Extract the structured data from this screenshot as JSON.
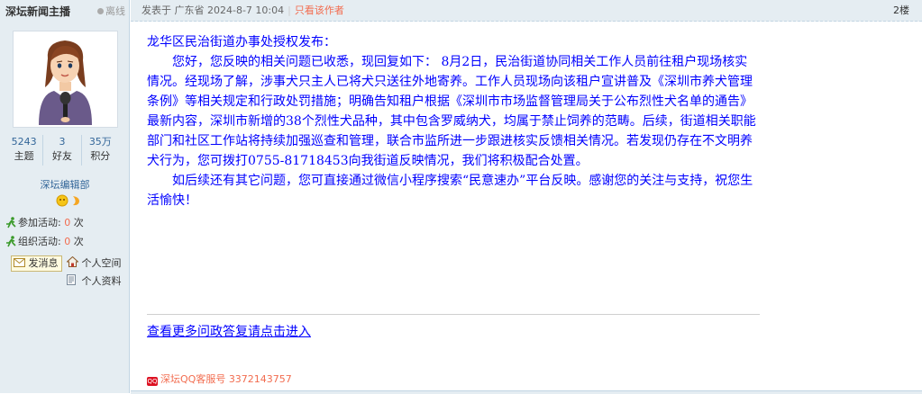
{
  "author": {
    "name": "深坛新闻主播",
    "status": "离线",
    "stats": [
      {
        "value": "5243",
        "label": "主题"
      },
      {
        "value": "3",
        "label": "好友"
      },
      {
        "value": "35万",
        "label": "积分"
      }
    ],
    "group": "深坛编辑部",
    "activities": [
      {
        "label": "参加活动:",
        "count": "0",
        "unit": "次"
      },
      {
        "label": "组织活动:",
        "count": "0",
        "unit": "次"
      }
    ],
    "message_button": "发消息",
    "space_link": "个人空间",
    "profile_link": "个人资料"
  },
  "post": {
    "posted_at": "发表于 广东省 2024-8-7 10:04",
    "author_only": "只看该作者",
    "floor": "2楼",
    "paragraphs": [
      "龙华区民治街道办事处授权发布：",
      "您好，您反映的相关问题已收悉，现回复如下： 8月2日，民治街道协同相关工作人员前往租户现场核实情况。经现场了解，涉事犬只主人已将犬只送往外地寄养。工作人员现场向该租户宣讲普及《深圳市养犬管理条例》等相关规定和行政处罚措施；明确告知租户根据《深圳市市场监督管理局关于公布烈性犬名单的通告》最新内容，深圳市新增的38个烈性犬品种，其中包含罗威纳犬，均属于禁止饲养的范畴。后续，街道相关职能部门和社区工作站将持续加强巡查和管理，联合市监所进一步跟进核实反馈相关情况。若发现仍存在不文明养犬行为，您可拨打0755-81718453向我街道反映情况，我们将积极配合处置。",
      "如后续还有其它问题，您可直接通过微信小程序搜索“民意速办”平台反映。感谢您的关注与支持，祝您生活愉快！"
    ],
    "more_link": "查看更多问政答复请点击进入",
    "qq_badge": "QQ",
    "qq_text": "深坛QQ客服号 3372143757"
  },
  "colors": {
    "body_text": "#0000ff",
    "accent_red": "#f26c4f",
    "sidebar_bg": "#e5edf2",
    "link_blue": "#336699"
  }
}
